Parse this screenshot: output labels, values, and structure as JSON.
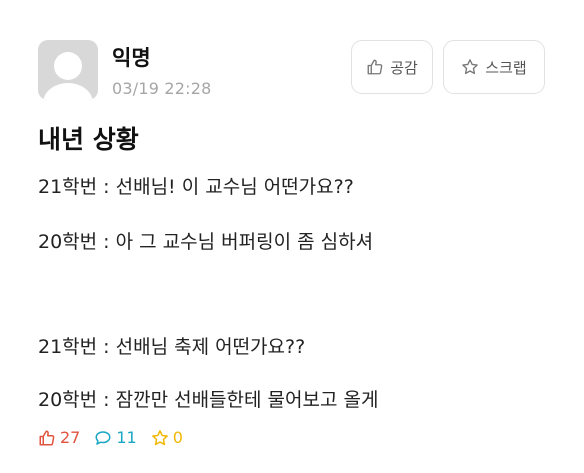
{
  "author": {
    "name": "익명",
    "date": "03/19 22:28"
  },
  "actions": {
    "like_label": "공감",
    "scrap_label": "스크랩"
  },
  "post": {
    "title": "내년 상황",
    "lines": [
      "21학번 : 선배님! 이 교수님 어떤가요??",
      "20학번 : 아 그 교수님 버퍼링이 좀 심하셔",
      "21학번 : 선배님 축제 어떤가요??",
      "20학번 : 잠깐만 선배들한테 물어보고 올게"
    ]
  },
  "stats": {
    "likes": "27",
    "comments": "11",
    "scraps": "0"
  },
  "colors": {
    "like": "#e0533d",
    "comment": "#1aa7c4",
    "scrap": "#f2b705",
    "date": "#a6a6a6"
  },
  "icons": {
    "like": "thumbs-up-icon",
    "comment": "speech-bubble-icon",
    "scrap": "star-icon",
    "avatar": "default-user-icon"
  }
}
